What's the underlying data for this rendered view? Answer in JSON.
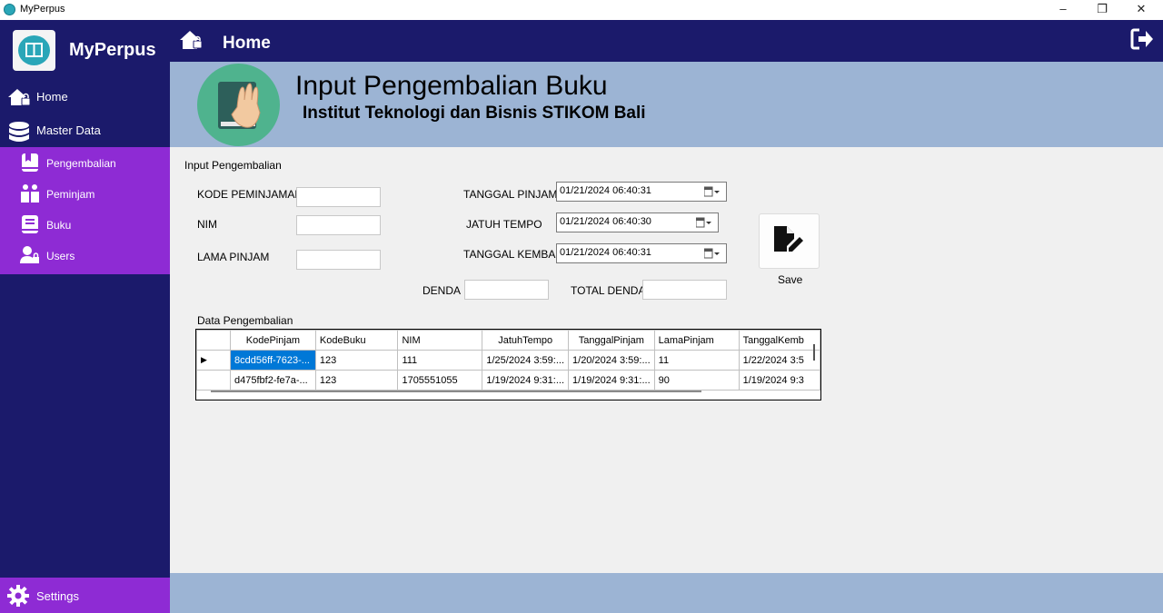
{
  "window": {
    "title": "MyPerpus",
    "minimize": "–",
    "restore": "❐",
    "close": "✕"
  },
  "sidebar": {
    "brand": "MyPerpus",
    "items": [
      {
        "label": "Home",
        "icon": "home-lock-icon"
      },
      {
        "label": "Master Data",
        "icon": "database-icon"
      }
    ],
    "submenu": [
      {
        "label": "Pengembalian",
        "icon": "return-book-icon"
      },
      {
        "label": "Peminjam",
        "icon": "borrower-icon"
      },
      {
        "label": "Buku",
        "icon": "book-icon"
      },
      {
        "label": "Users",
        "icon": "users-icon"
      }
    ],
    "settings": "Settings",
    "colors": {
      "sidebar": "#1b1a6b",
      "submenu": "#8e2bd4"
    }
  },
  "header": {
    "title": "Home"
  },
  "banner": {
    "heading": "Input Pengembalian Buku",
    "subheading": "Institut Teknologi dan Bisnis STIKOM Bali"
  },
  "form": {
    "section_title": "Input Pengembalian",
    "kode_peminjaman_label": "KODE PEMINJAMAN",
    "kode_peminjaman_value": "",
    "nim_label": "NIM",
    "nim_value": "",
    "lama_pinjam_label": "LAMA PINJAM",
    "lama_pinjam_value": "",
    "tanggal_pinjam_label": "TANGGAL PINJAM",
    "tanggal_pinjam_value": "01/21/2024 06:40:31",
    "jatuh_tempo_label": "JATUH TEMPO",
    "jatuh_tempo_value": "01/21/2024 06:40:30",
    "tanggal_kembali_label": "TANGGAL KEMBALI",
    "tanggal_kembali_value": "01/21/2024 06:40:31",
    "denda_label": "DENDA",
    "denda_value": "",
    "total_denda_label": "TOTAL DENDA",
    "total_denda_value": "",
    "save_label": "Save"
  },
  "table": {
    "title": "Data Pengembalian",
    "columns": [
      "KodePinjam",
      "KodeBuku",
      "NIM",
      "JatuhTempo",
      "TanggalPinjam",
      "LamaPinjam",
      "TanggalKemb"
    ],
    "rows": [
      [
        "8cdd56ff-7623-...",
        "123",
        "111",
        "1/25/2024 3:59:...",
        "1/20/2024 3:59:...",
        "11",
        "1/22/2024 3:5"
      ],
      [
        "d475fbf2-fe7a-...",
        "123",
        "1705551055",
        "1/19/2024 9:31:...",
        "1/19/2024 9:31:...",
        "90",
        "1/19/2024 9:3"
      ]
    ]
  }
}
